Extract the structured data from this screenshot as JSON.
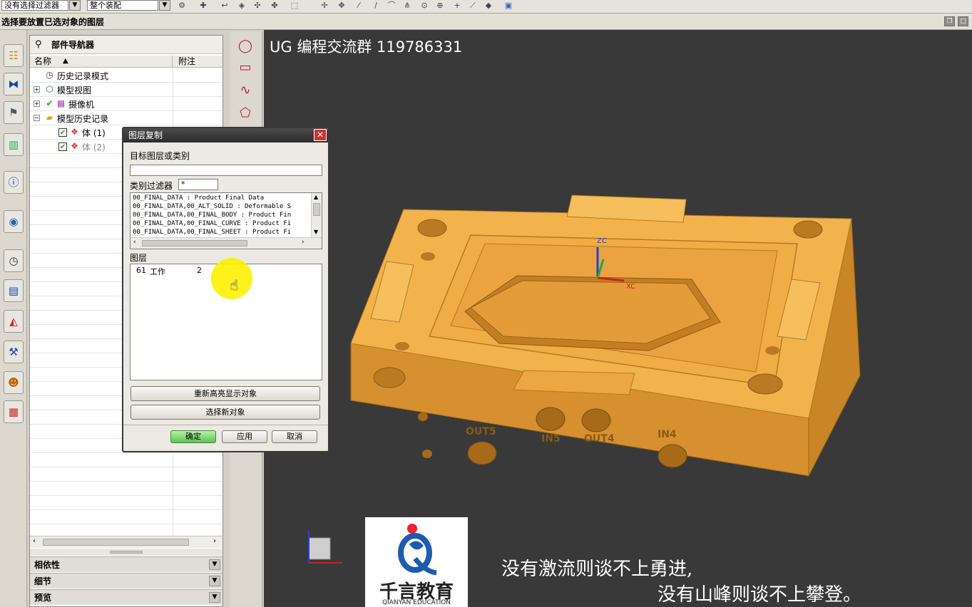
{
  "toolbar": {
    "filter_value": "没有选择过滤器",
    "assembly_value": "整个装配"
  },
  "cue": {
    "text": "选择要放置已选对象的图层"
  },
  "navigator": {
    "title": "部件导航器",
    "columns": {
      "name": "名称",
      "note": "附注"
    },
    "items": [
      {
        "label": "历史记录模式"
      },
      {
        "label": "模型视图"
      },
      {
        "label": "摄像机"
      },
      {
        "label": "模型历史记录"
      },
      {
        "label": "体 (1)"
      },
      {
        "label": "体 (2)"
      }
    ],
    "panels": [
      "相依性",
      "细节",
      "预览"
    ]
  },
  "viewport": {
    "title": "UG 编程交流群 119786331",
    "labels": [
      "OUT5",
      "IN5",
      "OUT4",
      "IN4"
    ],
    "axes": {
      "zc": "ZC",
      "xc": "XC"
    }
  },
  "dialog": {
    "title": "图层复制",
    "target_label": "目标图层或类别",
    "target_value": "",
    "filter_label": "类别过滤器",
    "filter_value": "*",
    "categories": [
      "00_FINAL_DATA : Product Final Data",
      "00_FINAL_DATA,00_ALT_SOLID : Deformable S",
      "00_FINAL_DATA,00_FINAL_BODY : Product Fin",
      "00_FINAL_DATA,00_FINAL_CURVE : Product Fi",
      "00_FINAL_DATA,00_FINAL_SHEET : Product Fi"
    ],
    "layer_label": "图层",
    "layers": [
      {
        "num": "61",
        "status": "工作",
        "count": "2"
      }
    ],
    "reselect_label": "重新高亮显示对象",
    "select_new_label": "选择新对象",
    "ok_label": "确定",
    "apply_label": "应用",
    "cancel_label": "取消"
  },
  "branding": {
    "logo_text": "千言教育",
    "logo_sub": "QIANYAN EDUCATION",
    "slogan_line1": "没有激流则谈不上勇进,",
    "slogan_line2": "没有山峰则谈不上攀登。"
  }
}
